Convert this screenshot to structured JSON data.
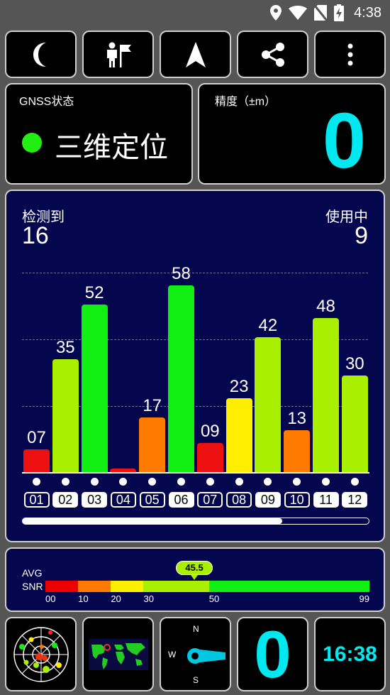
{
  "status_bar": {
    "time": "4:38"
  },
  "toolbar": {
    "buttons": [
      {
        "icon": "moon-icon"
      },
      {
        "icon": "person-flag-icon"
      },
      {
        "icon": "navigation-arrow-icon"
      },
      {
        "icon": "share-icon"
      },
      {
        "icon": "more-vert-icon"
      }
    ]
  },
  "gnss_status": {
    "title": "GNSS状态",
    "value": "三维定位",
    "indicator_color": "#22ee11"
  },
  "accuracy": {
    "title": "精度（±m）",
    "value": "0",
    "value_color": "#00e8f0"
  },
  "satellites": {
    "detected_label": "检测到",
    "detected_count": "16",
    "used_label": "使用中",
    "used_count": "9",
    "scroll_progress": 0.75,
    "bars": [
      {
        "id": "01",
        "snr": 7,
        "label": "07",
        "used": false,
        "color": "#ee1111"
      },
      {
        "id": "02",
        "snr": 35,
        "label": "35",
        "used": true,
        "color": "#a8f000"
      },
      {
        "id": "03",
        "snr": 52,
        "label": "52",
        "used": true,
        "color": "#11ee11"
      },
      {
        "id": "04",
        "snr": 1,
        "label": "",
        "used": false,
        "color": "#ee1111"
      },
      {
        "id": "05",
        "snr": 17,
        "label": "17",
        "used": false,
        "color": "#ff7a00"
      },
      {
        "id": "06",
        "snr": 58,
        "label": "58",
        "used": true,
        "color": "#11ee11"
      },
      {
        "id": "07",
        "snr": 9,
        "label": "09",
        "used": false,
        "color": "#ee1111"
      },
      {
        "id": "08",
        "snr": 23,
        "label": "23",
        "used": false,
        "color": "#ffee00"
      },
      {
        "id": "09",
        "snr": 42,
        "label": "42",
        "used": true,
        "color": "#a8f000"
      },
      {
        "id": "10",
        "snr": 13,
        "label": "13",
        "used": false,
        "color": "#ff7a00"
      },
      {
        "id": "11",
        "snr": 48,
        "label": "48",
        "used": true,
        "color": "#a8f000"
      },
      {
        "id": "12",
        "snr": 30,
        "label": "30",
        "used": true,
        "color": "#a8f000"
      }
    ]
  },
  "avg_snr": {
    "label_avg": "AVG",
    "label_snr": "SNR",
    "value": "45.5",
    "value_num": 45.5,
    "scale_max": 99,
    "ticks": [
      "00",
      "10",
      "20",
      "30",
      "50",
      "99"
    ],
    "segments": [
      {
        "from": 0,
        "to": 10,
        "color": "#ee0000"
      },
      {
        "from": 10,
        "to": 20,
        "color": "#ff7a00"
      },
      {
        "from": 20,
        "to": 30,
        "color": "#ffee00"
      },
      {
        "from": 30,
        "to": 50,
        "color": "#a8f000"
      },
      {
        "from": 50,
        "to": 99,
        "color": "#11ee11"
      }
    ]
  },
  "bottom": {
    "compass": {
      "n": "N",
      "s": "S",
      "w": "W"
    },
    "big_value": "0",
    "big_value_color": "#00e8f0",
    "clock": "16:38",
    "clock_color": "#00e8f0"
  }
}
